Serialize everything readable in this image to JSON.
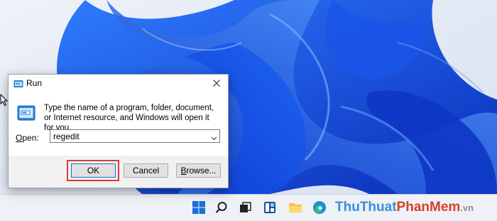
{
  "run_dialog": {
    "title": "Run",
    "description": "Type the name of a program, folder, document, or Internet resource, and Windows will open it for you.",
    "open_label": "Open:",
    "open_label_accesskey": "O",
    "open_label_rest": "pen:",
    "input_value": "regedit",
    "ok_label": "OK",
    "cancel_label": "Cancel",
    "browse_label": "Browse...",
    "browse_accesskey": "B",
    "browse_rest": "rowse..."
  },
  "watermark": {
    "part1": "Thu",
    "part2": "Thuat",
    "part3": "Phan",
    "part4": "Mem",
    "part5": ".vn"
  },
  "colors": {
    "accent": "#0078d7",
    "highlight": "#e03a3a",
    "wallpaper": "#1447d6"
  }
}
